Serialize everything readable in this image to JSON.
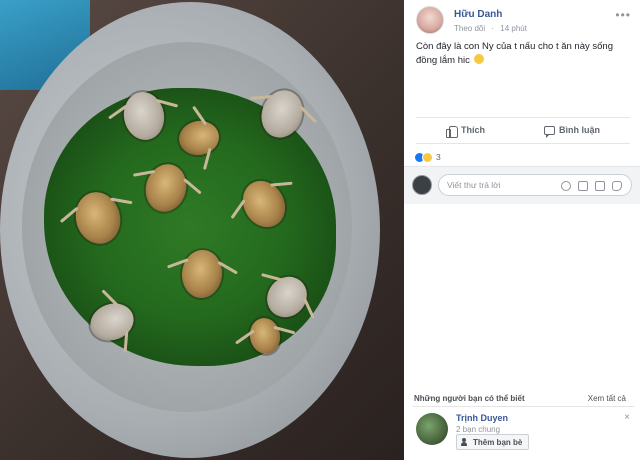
{
  "post": {
    "author": "Hữu Danh",
    "follow": "Theo dõi",
    "time": "14 phút",
    "text": "Còn đây là con Ny của t nấu cho t ăn này sống đồng lắm hic",
    "more_icon": "more-dots-icon",
    "sad_emoji": "sad-face-emoji"
  },
  "actions": {
    "like_label": "Thích",
    "comment_label": "Bình luận",
    "like_icon": "thumbs-up-icon",
    "comment_icon": "comment-bubble-icon"
  },
  "reactions": {
    "types": [
      "like",
      "haha"
    ],
    "count": "3"
  },
  "reply": {
    "placeholder": "Viết thư trả lời",
    "icons": [
      "emoji-icon",
      "camera-icon",
      "gif-icon",
      "sticker-icon"
    ]
  },
  "suggestions": {
    "title": "Những người bạn có thể biết",
    "see_all": "Xem tất cả",
    "friend": {
      "name": "Trịnh Duyen",
      "mutual": "2 bạn chung",
      "add_label": "Thêm bạn bè"
    },
    "close": "×"
  },
  "colors": {
    "link_blue": "#385898",
    "like_blue": "#1877f2",
    "haha_yellow": "#f7c843",
    "meta_gray": "#90949c"
  }
}
